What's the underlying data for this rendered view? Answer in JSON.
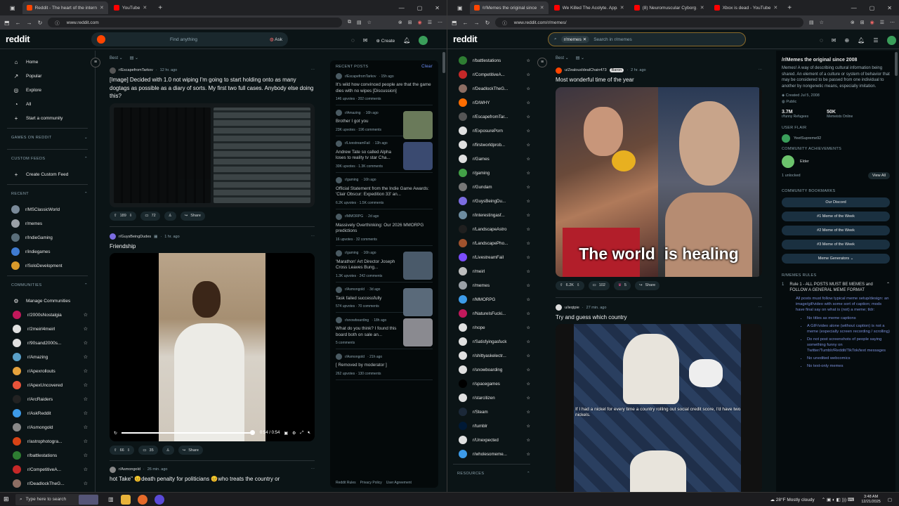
{
  "left": {
    "tabs": [
      {
        "label": "Reddit - The heart of the intern",
        "color": "#ff4500"
      },
      {
        "label": "YouTube",
        "color": "#ff0000"
      }
    ],
    "url": "www.reddit.com",
    "logo": "reddit",
    "search_placeholder": "Find anything",
    "ask_label": "Ask",
    "create_label": "Create",
    "nav": [
      {
        "label": "Home",
        "icon": "home-icon",
        "glyph": "⌂"
      },
      {
        "label": "Popular",
        "icon": "popular-icon",
        "glyph": "↗"
      },
      {
        "label": "Explore",
        "icon": "explore-icon",
        "glyph": "◎"
      },
      {
        "label": "All",
        "icon": "all-icon",
        "glyph": "◔"
      },
      {
        "label": "Start a community",
        "icon": "plus-icon",
        "glyph": "+"
      }
    ],
    "sections": {
      "games": "GAMES ON REDDIT",
      "custom": "CUSTOM FEEDS",
      "recent": "RECENT",
      "communities": "COMMUNITIES"
    },
    "create_custom_feed": "Create Custom Feed",
    "recent": [
      {
        "name": "r/MSClassicWorld",
        "color": "#7a8a99"
      },
      {
        "name": "r/memes",
        "color": "#9aa0a6"
      },
      {
        "name": "r/IndieGaming",
        "color": "#5a6e7a"
      },
      {
        "name": "r/indiegames",
        "color": "#3f7bd1"
      },
      {
        "name": "r/SoloDevelopment",
        "color": "#d99a2b"
      }
    ],
    "manage_communities": "Manage Communities",
    "communities": [
      {
        "name": "r/2000sNostalgia",
        "color": "#c2185b"
      },
      {
        "name": "r/2meirl4meirl",
        "color": "#e0e0e0"
      },
      {
        "name": "r/90sand2000s...",
        "color": "#e0e0e0"
      },
      {
        "name": "r/Amazing",
        "color": "#5aa0c8"
      },
      {
        "name": "r/Apexrollouts",
        "color": "#e6a23c"
      },
      {
        "name": "r/ApexUncovered",
        "color": "#e8533a"
      },
      {
        "name": "r/ArcRaiders",
        "color": "#222"
      },
      {
        "name": "r/AskReddit",
        "color": "#3d9be9"
      },
      {
        "name": "r/Asmongold",
        "color": "#888"
      },
      {
        "name": "r/astrophotogra...",
        "color": "#d84315"
      },
      {
        "name": "r/battlestations",
        "color": "#2e7d32"
      },
      {
        "name": "r/CompetitiveA...",
        "color": "#c62828"
      },
      {
        "name": "r/DeadlockTheG...",
        "color": "#8d6e63"
      }
    ],
    "sort": "Best",
    "posts": [
      {
        "sub": "r/EscapefromTarkov",
        "time": "12 hr. ago",
        "title": "[Image] Decided with 1.0 not wiping I'm going to start holding onto as many dogtags as possible as a diary of sorts. My first two full cases. Anybody else doing this?",
        "votes": "189",
        "comments": "72",
        "share": "Share"
      },
      {
        "sub": "r/GuysBeingDudes",
        "time": "1 hr. ago",
        "title": "Friendship",
        "votes": "66",
        "comments": "35",
        "share": "Share",
        "video_time": "0:54 / 0:54"
      },
      {
        "sub": "r/Asmongold",
        "time": "26 min. ago",
        "title": "hot Take\" 😊death penalty for politicians 😊who treats the country or"
      }
    ],
    "recent_posts": {
      "header": "RECENT POSTS",
      "clear": "Clear",
      "items": [
        {
          "sub": "r/EscapefromTarkov",
          "time": "15h ago",
          "title": "It's wild how convinced people are that the game dies with no wipes [Discussion]",
          "upvotes": "146 upvotes",
          "comments": "202 comments",
          "thumb": false
        },
        {
          "sub": "r/Amazing",
          "time": "16h ago",
          "title": "Brother I got you",
          "upvotes": "23K upvotes",
          "comments": "196 comments",
          "thumb": true
        },
        {
          "sub": "r/LivestreamFail",
          "time": "13h ago",
          "title": "Andrew Tate so called Alpha loses to reality tv star Cha...",
          "upvotes": "30K upvotes",
          "comments": "1.3K comments",
          "thumb": true
        },
        {
          "sub": "r/gaming",
          "time": "16h ago",
          "title": "Official Statement from the Indie Game Awards: 'Clair Obscur: Expedition 33' an...",
          "upvotes": "6.2K upvotes",
          "comments": "1.5K comments",
          "thumb": false
        },
        {
          "sub": "r/MMORPG",
          "time": "2d ago",
          "title": "Massively Overthinking: Our 2026 MMORPG predictions",
          "upvotes": "16 upvotes",
          "comments": "32 comments",
          "thumb": false
        },
        {
          "sub": "r/gaming",
          "time": "16h ago",
          "title": "'Marathon' Art Director Joseph Cross Leaves Bung...",
          "upvotes": "1.3K upvotes",
          "comments": "242 comments",
          "thumb": true
        },
        {
          "sub": "r/Asmongold",
          "time": "3d ago",
          "title": "Task failed successfully",
          "upvotes": "574 upvotes",
          "comments": "70 comments",
          "thumb": true
        },
        {
          "sub": "r/snowboarding",
          "time": "18h ago",
          "title": "What do you think? I found this board both on sale an...",
          "upvotes": "",
          "comments": "5 comments",
          "thumb": true
        },
        {
          "sub": "r/Asmongold",
          "time": "21h ago",
          "title": "[ Removed by moderator ]",
          "upvotes": "262 upvotes",
          "comments": "130 comments",
          "thumb": false
        }
      ],
      "footer": [
        "Reddit Rules",
        "Privacy Policy",
        "User Agreement"
      ]
    }
  },
  "right": {
    "tabs": [
      {
        "label": "/r/Memes the original since 20",
        "color": "#ff4500"
      },
      {
        "label": "We Killed The Acolyte. Appa",
        "color": "#ff0000"
      },
      {
        "label": "(8) Neuromuscular Cyborg Arm",
        "color": "#ff0000"
      },
      {
        "label": "Xbox is dead - YouTube",
        "color": "#ff0000"
      }
    ],
    "url": "www.reddit.com/r/memes/",
    "chip": "r/memes",
    "search_placeholder": "Search in r/memes",
    "communities": [
      {
        "name": "r/battlestations",
        "color": "#2e7d32"
      },
      {
        "name": "r/CompetitiveA...",
        "color": "#c62828"
      },
      {
        "name": "r/DeadlockTheG...",
        "color": "#8d6e63"
      },
      {
        "name": "r/DIWHY",
        "color": "#ff6d00"
      },
      {
        "name": "r/EscapefromTar...",
        "color": "#555"
      },
      {
        "name": "r/ExposurePorn",
        "color": "#e0e0e0"
      },
      {
        "name": "r/firstworldprob...",
        "color": "#e0e0e0"
      },
      {
        "name": "r/Games",
        "color": "#e0e0e0"
      },
      {
        "name": "r/gaming",
        "color": "#43a047"
      },
      {
        "name": "r/Gundam",
        "color": "#777"
      },
      {
        "name": "r/GuysBeingDu...",
        "color": "#7b6ce0"
      },
      {
        "name": "r/interestingasf...",
        "color": "#6d8ca0"
      },
      {
        "name": "r/LandscapeAstro",
        "color": "#1f1f1f"
      },
      {
        "name": "r/LandscapePho...",
        "color": "#a0522d"
      },
      {
        "name": "r/LivestreamFail",
        "color": "#7c4dff"
      },
      {
        "name": "r/meirl",
        "color": "#bdbdbd"
      },
      {
        "name": "r/memes",
        "color": "#9aa0a6"
      },
      {
        "name": "r/MMORPG",
        "color": "#3d9be9"
      },
      {
        "name": "r/NatureIsFucki...",
        "color": "#c2185b"
      },
      {
        "name": "r/nope",
        "color": "#e0e0e0"
      },
      {
        "name": "r/Satisfyingasfuck",
        "color": "#e0e0e0"
      },
      {
        "name": "r/shittyaskelectr...",
        "color": "#e0e0e0"
      },
      {
        "name": "r/snowboarding",
        "color": "#e0e0e0"
      },
      {
        "name": "r/spacegames",
        "color": "#000"
      },
      {
        "name": "r/starcitizen",
        "color": "#e0e0e0"
      },
      {
        "name": "r/Steam",
        "color": "#1b2838"
      },
      {
        "name": "r/tumblr",
        "color": "#001935"
      },
      {
        "name": "r/Unexpected",
        "color": "#e0e0e0"
      },
      {
        "name": "r/wholesomeme...",
        "color": "#3d9be9"
      }
    ],
    "resources": "RESOURCES",
    "sort": "Best",
    "posts": [
      {
        "user": "u/ZealousIdealChain473",
        "flair": "Baron",
        "time": "2 hr. ago",
        "title": "Most wonderful time of the year",
        "caption": "The world  is healing",
        "votes": "6.2K",
        "comments": "102",
        "awards": "5",
        "share": "Share"
      },
      {
        "user": "u/ieqtpie",
        "time": "27 min. ago",
        "title": "Try and guess which country",
        "caption": "If I had a nickel for every time a country rolling out social credit score, I'd have two nickels."
      }
    ],
    "about": {
      "title": "/r/Memes the original since 2008",
      "desc": "Memes! A way of describing cultural information being shared. An element of a culture or system of behavior that may be considered to be passed from one individual to another by nongenetic means, especially imitation.",
      "created": "Created Jul 5, 2008",
      "visibility": "Public",
      "members": "3.7M",
      "members_label": "r/funny Refugees",
      "online": "50K",
      "online_label": "Memeists Online",
      "user_flair_h": "USER FLAIR",
      "user_flair": "YeetSupreme92",
      "ach_h": "COMMUNITY ACHIEVEMENTS",
      "ach": "Elder",
      "unlocked": "1 unlocked",
      "view_all": "View All",
      "bm_h": "COMMUNITY BOOKMARKS",
      "bookmarks": [
        "Our Discord",
        "#1 Meme of the Week",
        "#2 Meme of the Week",
        "#3 Meme of the Week",
        "Meme Generators ⌄"
      ],
      "rules_h": "R/MEMES RULES",
      "rule1": "Rule 1 - ALL POSTS MUST BE MEMES and FOLLOW A GENERAL MEME FORMAT",
      "rule_text": "All posts must follow typical meme setup/design: an image/gif/video with some sort of caption; mods have final say on what is (not) a meme; tldr:",
      "bullets": [
        "No titles as meme captions",
        "A GIF/video alone (without caption) is not a meme (especially screen recording / scrolling)",
        "Do not post screenshots of people saying something funny on Twitter/Tumblr/Reddit/TikTok/text messages",
        "No unedited webcomics",
        "No text-only memes"
      ]
    }
  },
  "taskbar": {
    "search": "Type here to search",
    "weather": "28°F  Mostly cloudy",
    "time": "3:48 AM",
    "date": "12/21/2025"
  }
}
